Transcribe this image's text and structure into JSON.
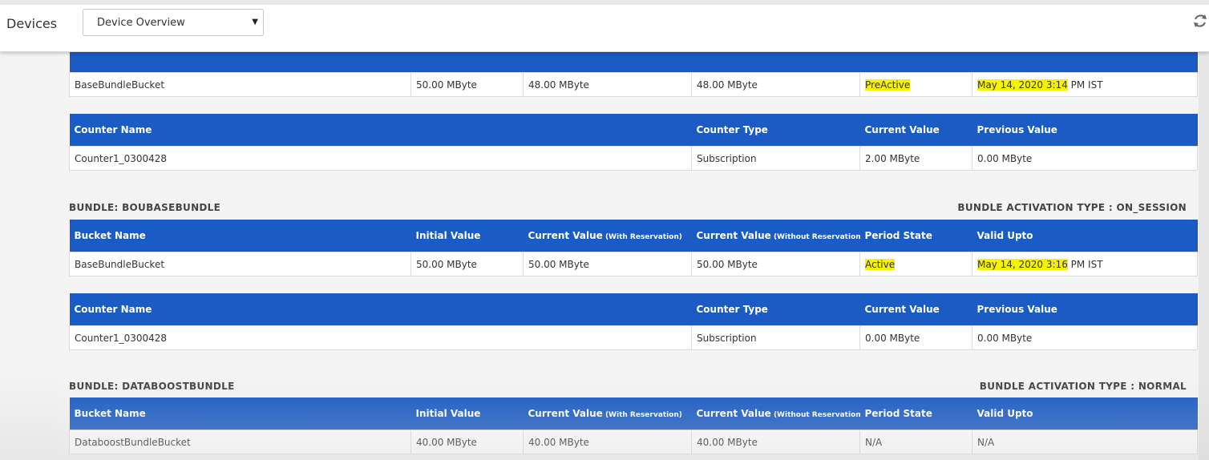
{
  "header": {
    "title": "Devices",
    "dropdown_value": "Device Overview",
    "dropdown_arrow": "▼",
    "refresh_icon": "refresh-icon"
  },
  "top_bucket_row": {
    "cells": [
      "BaseBundleBucket",
      "50.00 MByte",
      "48.00 MByte",
      "48.00 MByte",
      "PreActive",
      "May 14, 2020 3:14",
      " PM IST"
    ]
  },
  "counter_table_1": {
    "headers": [
      "Counter Name",
      "Counter Type",
      "Current Value",
      "Previous Value"
    ],
    "row": [
      "Counter1_0300428",
      "Subscription",
      "2.00 MByte",
      "0.00 MByte"
    ]
  },
  "bundle_2": {
    "title": "BUNDLE: BOUBASEBUNDLE",
    "activation": "BUNDLE ACTIVATION TYPE : ON_SESSION",
    "headers": {
      "bucket": "Bucket Name",
      "initial": "Initial Value",
      "current_with": "Current Value",
      "current_with_sub": " (With Reservation)",
      "current_without": "Current Value",
      "current_without_sub": " (Without Reservation)",
      "period": "Period State",
      "valid": "Valid Upto"
    },
    "row": [
      "BaseBundleBucket",
      "50.00 MByte",
      "50.00 MByte",
      "50.00 MByte",
      "Active",
      "May 14, 2020 3:16",
      " PM IST"
    ]
  },
  "counter_table_2": {
    "headers": [
      "Counter Name",
      "Counter Type",
      "Current Value",
      "Previous Value"
    ],
    "row": [
      "Counter1_0300428",
      "Subscription",
      "0.00 MByte",
      "0.00 MByte"
    ]
  },
  "bundle_3": {
    "title": "BUNDLE: DATABOOSTBUNDLE",
    "activation": "BUNDLE ACTIVATION TYPE : NORMAL",
    "headers": {
      "bucket": "Bucket Name",
      "initial": "Initial Value",
      "current_with": "Current Value",
      "current_with_sub": " (With Reservation)",
      "current_without": "Current Value",
      "current_without_sub": " (Without Reservation)",
      "period": "Period State",
      "valid": "Valid Upto"
    },
    "row": [
      "DataboostBundleBucket",
      "40.00 MByte",
      "40.00 MByte",
      "40.00 MByte",
      "N/A",
      "N/A"
    ]
  },
  "colors": {
    "header_blue": "#1a5bc4",
    "highlight": "#f6f200"
  }
}
